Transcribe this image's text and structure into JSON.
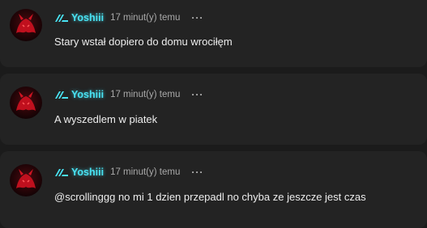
{
  "comments": [
    {
      "author": "Yoshiii",
      "time": "17 minut(y) temu",
      "more": "···",
      "text": "Stary wstał dopiero do domu wrociłęm",
      "badge_icon": "rank-chevron-icon",
      "avatar_icon": "red-creature-avatar"
    },
    {
      "author": "Yoshiii",
      "time": "17 minut(y) temu",
      "more": "···",
      "text": "A wyszedlem w piatek",
      "badge_icon": "rank-chevron-icon",
      "avatar_icon": "red-creature-avatar"
    },
    {
      "author": "Yoshiii",
      "time": "17 minut(y) temu",
      "more": "···",
      "text": "@scrollinggg no mi 1 dzien przepadl no chyba ze jeszcze jest czas",
      "badge_icon": "rank-chevron-icon",
      "avatar_icon": "red-creature-avatar"
    }
  ],
  "colors": {
    "background": "#1b1b1b",
    "card": "#232323",
    "username": "#49e3f3",
    "timestamp": "#a9a9a9",
    "text": "#ededed",
    "avatar_accent": "#c0101e"
  }
}
